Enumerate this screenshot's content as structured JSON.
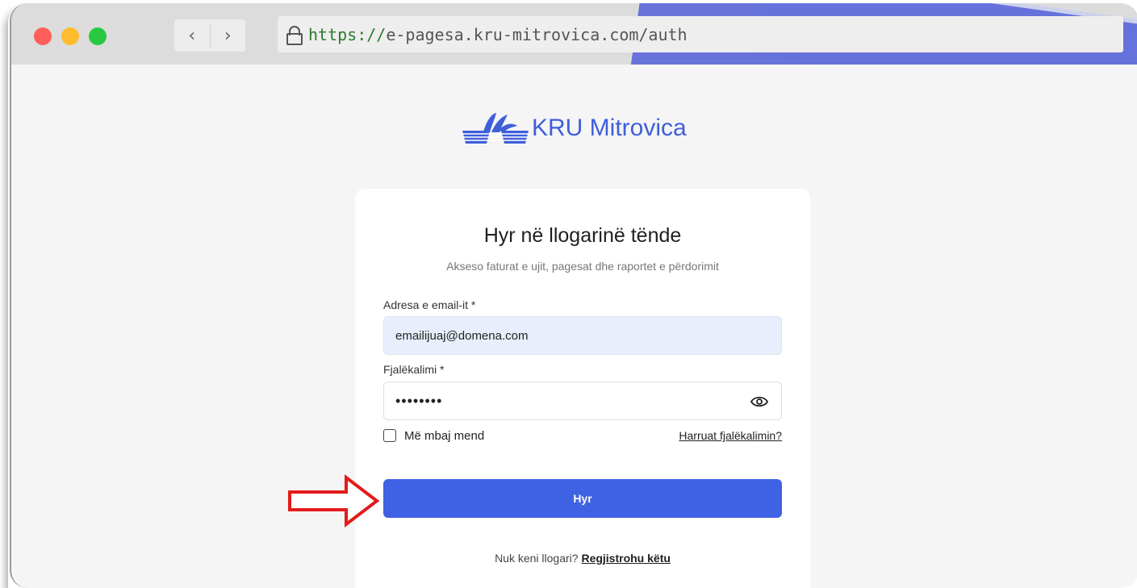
{
  "browser": {
    "url_scheme": "https://",
    "url_rest": "e-pagesa.kru-mitrovica.com/auth",
    "back_glyph": "‹",
    "forward_glyph": "›",
    "traffic_lights": {
      "close": "#fe5f58",
      "minimize": "#febc2e",
      "maximize": "#28c840"
    },
    "accent_color": "#5b67d9"
  },
  "brand": {
    "name": "KRU Mitrovica",
    "logo_icon": "kru-logo-icon",
    "color": "#3f5fd9"
  },
  "login": {
    "title": "Hyr në llogarinë tënde",
    "subtitle": "Akseso faturat e ujit, pagesat dhe raportet e përdorimit",
    "email_label": "Adresa e email-it *",
    "email_value": "emailijuaj@domena.com",
    "password_label": "Fjalëkalimi *",
    "password_value": "••••••••",
    "password_toggle_icon": "eye-icon",
    "remember_label": "Më mbaj mend",
    "forgot_link": "Harruat fjalëkalimin?",
    "submit_label": "Hyr",
    "submit_color": "#3f61e3",
    "signup_prompt": "Nuk keni llogari?",
    "signup_link": "Regjistrohu këtu"
  },
  "annotation": {
    "arrow_color": "#e31b1b",
    "arrow_icon": "red-arrow-icon"
  }
}
